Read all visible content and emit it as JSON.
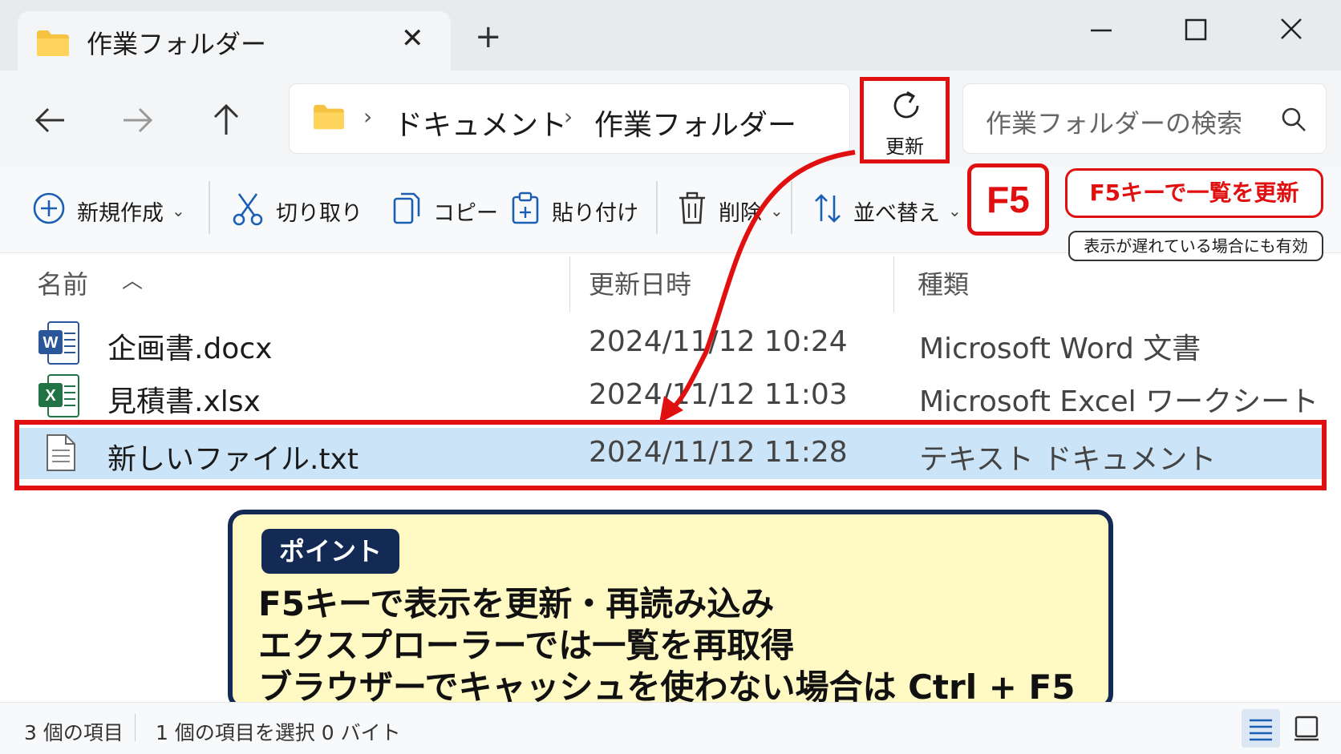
{
  "window": {
    "tab_title": "作業フォルダー",
    "new_tab": "+"
  },
  "nav": {
    "breadcrumb": [
      "ドキュメント",
      "作業フォルダー"
    ],
    "refresh_label": "更新",
    "search_placeholder": "作業フォルダーの検索"
  },
  "commands": {
    "new": "新規作成",
    "cut": "切り取り",
    "copy": "コピー",
    "paste": "貼り付け",
    "delete": "削除",
    "sort": "並べ替え"
  },
  "annotation": {
    "key": "F5",
    "callout": "F5キーで一覧を更新",
    "note": "表示が遅れている場合にも有効"
  },
  "columns": {
    "name": "名前",
    "date": "更新日時",
    "type": "種類"
  },
  "files": [
    {
      "name": "企画書.docx",
      "date": "2024/11/12  10:24",
      "type": "Microsoft Word 文書",
      "icon": "word-icon"
    },
    {
      "name": "見積書.xlsx",
      "date": "2024/11/12  11:03",
      "type": "Microsoft Excel ワークシート",
      "icon": "excel-icon"
    },
    {
      "name": "新しいファイル.txt",
      "date": "2024/11/12  11:28",
      "type": "テキスト ドキュメント",
      "icon": "text-file-icon",
      "selected": true
    }
  ],
  "point": {
    "tag": "ポイント",
    "lines": [
      "F5キーで表示を更新・再読み込み",
      "エクスプローラーでは一覧を再取得",
      "ブラウザーでキャッシュを使わない場合は Ctrl + F5"
    ]
  },
  "status": {
    "count": "3 個の項目",
    "selection": "1 個の項目を選択  0 バイト"
  },
  "colors": {
    "accent_red": "#e01010",
    "selection": "#cce4f7",
    "point_bg": "#fff9c4",
    "point_border": "#132a55"
  }
}
